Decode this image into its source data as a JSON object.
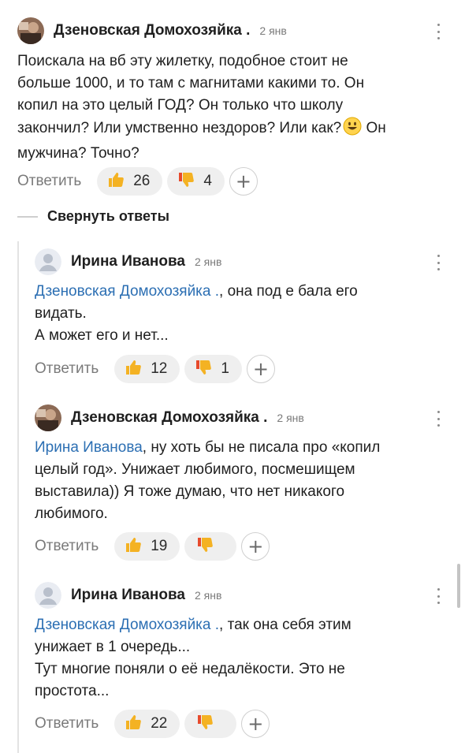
{
  "comments": [
    {
      "author": "Дзеновская Домохозяйка .",
      "date": "2 янв",
      "text_lines": [
        "Поискала на вб эту жилетку, подобное стоит не",
        "больше 1000, и то там с магнитами какими то. Он",
        "копил на это целый ГОД? Он только что школу",
        "закончил? Или умственно нездоров? Или как?",
        "мужчина? Точно?"
      ],
      "emoji_tail": "😃",
      "line4_tail": " Он",
      "reply_label": "Ответить",
      "likes": "26",
      "dislikes": "4",
      "plus": "+"
    },
    {
      "author": "Ирина Иванова",
      "date": "2 янв",
      "mention": "Дзеновская Домохозяйка .",
      "text_lines": [
        ", она под е бала его",
        "видать.",
        "А может его и нет..."
      ],
      "reply_label": "Ответить",
      "likes": "12",
      "dislikes": "1",
      "plus": "+"
    },
    {
      "author": "Дзеновская Домохозяйка .",
      "date": "2 янв",
      "mention": "Ирина Иванова",
      "text_lines": [
        ", ну хоть бы не писала про «копил",
        "целый год». Унижает любимого, посмешищем",
        "выставила)) Я тоже думаю, что нет никакого",
        "любимого."
      ],
      "reply_label": "Ответить",
      "likes": "19",
      "dislikes": "",
      "plus": "+"
    },
    {
      "author": "Ирина Иванова",
      "date": "2 янв",
      "mention": "Дзеновская Домохозяйка .",
      "text_lines": [
        ", так она себя этим",
        "унижает в 1 очередь...",
        "Тут многие поняли о её недалёкости. Это не",
        "простота..."
      ],
      "reply_label": "Ответить",
      "likes": "22",
      "dislikes": "",
      "plus": "+"
    }
  ],
  "collapse_replies_label": "Свернуть ответы",
  "colors": {
    "mention": "#2c6fb3",
    "pill_bg": "#efefef",
    "thumb_up": "#f4b223",
    "thumb_down": "#e74a2c"
  }
}
